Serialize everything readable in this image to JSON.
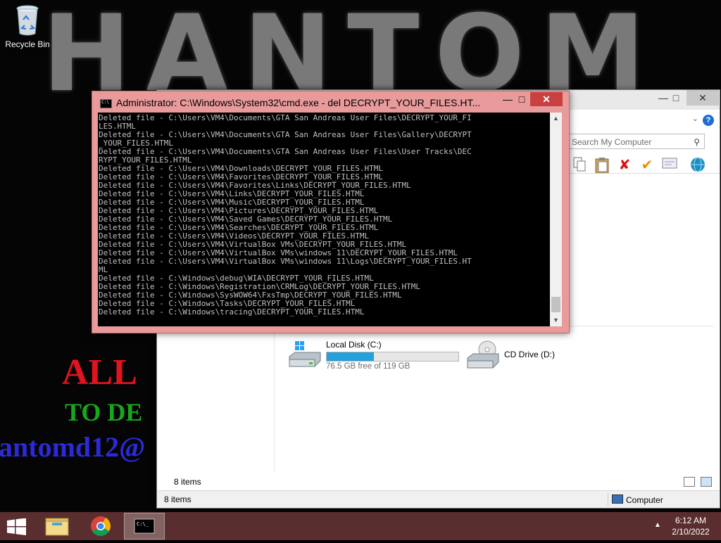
{
  "desktop": {
    "recycle_bin_label": "Recycle Bin",
    "wallpaper": {
      "big_text": "HANTOM",
      "red_text": "ALL",
      "green_text": "TO DE",
      "blue_text": "antomd12@"
    }
  },
  "explorer": {
    "search_placeholder": "Search My Computer",
    "help_label": "?",
    "drives": [
      {
        "name": "Local Disk (C:)",
        "free_text": "76.5 GB free of 119 GB",
        "used_fraction": 0.36
      },
      {
        "name": "CD Drive (D:)"
      }
    ],
    "items_inner": "8 items",
    "items_status": "8 items",
    "computer_label": "Computer"
  },
  "cmd": {
    "title": "Administrator: C:\\Windows\\System32\\cmd.exe - del  DECRYPT_YOUR_FILES.HT...",
    "lines": [
      "Deleted file - C:\\Users\\VM4\\Documents\\GTA San Andreas User Files\\DECRYPT_YOUR_FI",
      "LES.HTML",
      "Deleted file - C:\\Users\\VM4\\Documents\\GTA San Andreas User Files\\Gallery\\DECRYPT",
      "_YOUR_FILES.HTML",
      "Deleted file - C:\\Users\\VM4\\Documents\\GTA San Andreas User Files\\User Tracks\\DEC",
      "RYPT_YOUR_FILES.HTML",
      "Deleted file - C:\\Users\\VM4\\Downloads\\DECRYPT_YOUR_FILES.HTML",
      "Deleted file - C:\\Users\\VM4\\Favorites\\DECRYPT_YOUR_FILES.HTML",
      "Deleted file - C:\\Users\\VM4\\Favorites\\Links\\DECRYPT_YOUR_FILES.HTML",
      "Deleted file - C:\\Users\\VM4\\Links\\DECRYPT_YOUR_FILES.HTML",
      "Deleted file - C:\\Users\\VM4\\Music\\DECRYPT_YOUR_FILES.HTML",
      "Deleted file - C:\\Users\\VM4\\Pictures\\DECRYPT_YOUR_FILES.HTML",
      "Deleted file - C:\\Users\\VM4\\Saved Games\\DECRYPT_YOUR_FILES.HTML",
      "Deleted file - C:\\Users\\VM4\\Searches\\DECRYPT_YOUR_FILES.HTML",
      "Deleted file - C:\\Users\\VM4\\Videos\\DECRYPT_YOUR_FILES.HTML",
      "Deleted file - C:\\Users\\VM4\\VirtualBox VMs\\DECRYPT_YOUR_FILES.HTML",
      "Deleted file - C:\\Users\\VM4\\VirtualBox VMs\\windows 11\\DECRYPT_YOUR_FILES.HTML",
      "Deleted file - C:\\Users\\VM4\\VirtualBox VMs\\windows 11\\Logs\\DECRYPT_YOUR_FILES.HT",
      "ML",
      "Deleted file - C:\\Windows\\debug\\WIA\\DECRYPT_YOUR_FILES.HTML",
      "Deleted file - C:\\Windows\\Registration\\CRMLog\\DECRYPT_YOUR_FILES.HTML",
      "Deleted file - C:\\Windows\\SysWOW64\\FxsTmp\\DECRYPT_YOUR_FILES.HTML",
      "Deleted file - C:\\Windows\\Tasks\\DECRYPT_YOUR_FILES.HTML",
      "Deleted file - C:\\Windows\\tracing\\DECRYPT_YOUR_FILES.HTML"
    ]
  },
  "taskbar": {
    "time": "6:12 AM",
    "date": "2/10/2022",
    "tray_arrow": "▲"
  },
  "colors": {
    "taskbar": "#5a2e2e",
    "cmd_frame": "#e99a9a",
    "cmd_close": "#c84040",
    "drive_bar": "#26a0da"
  }
}
